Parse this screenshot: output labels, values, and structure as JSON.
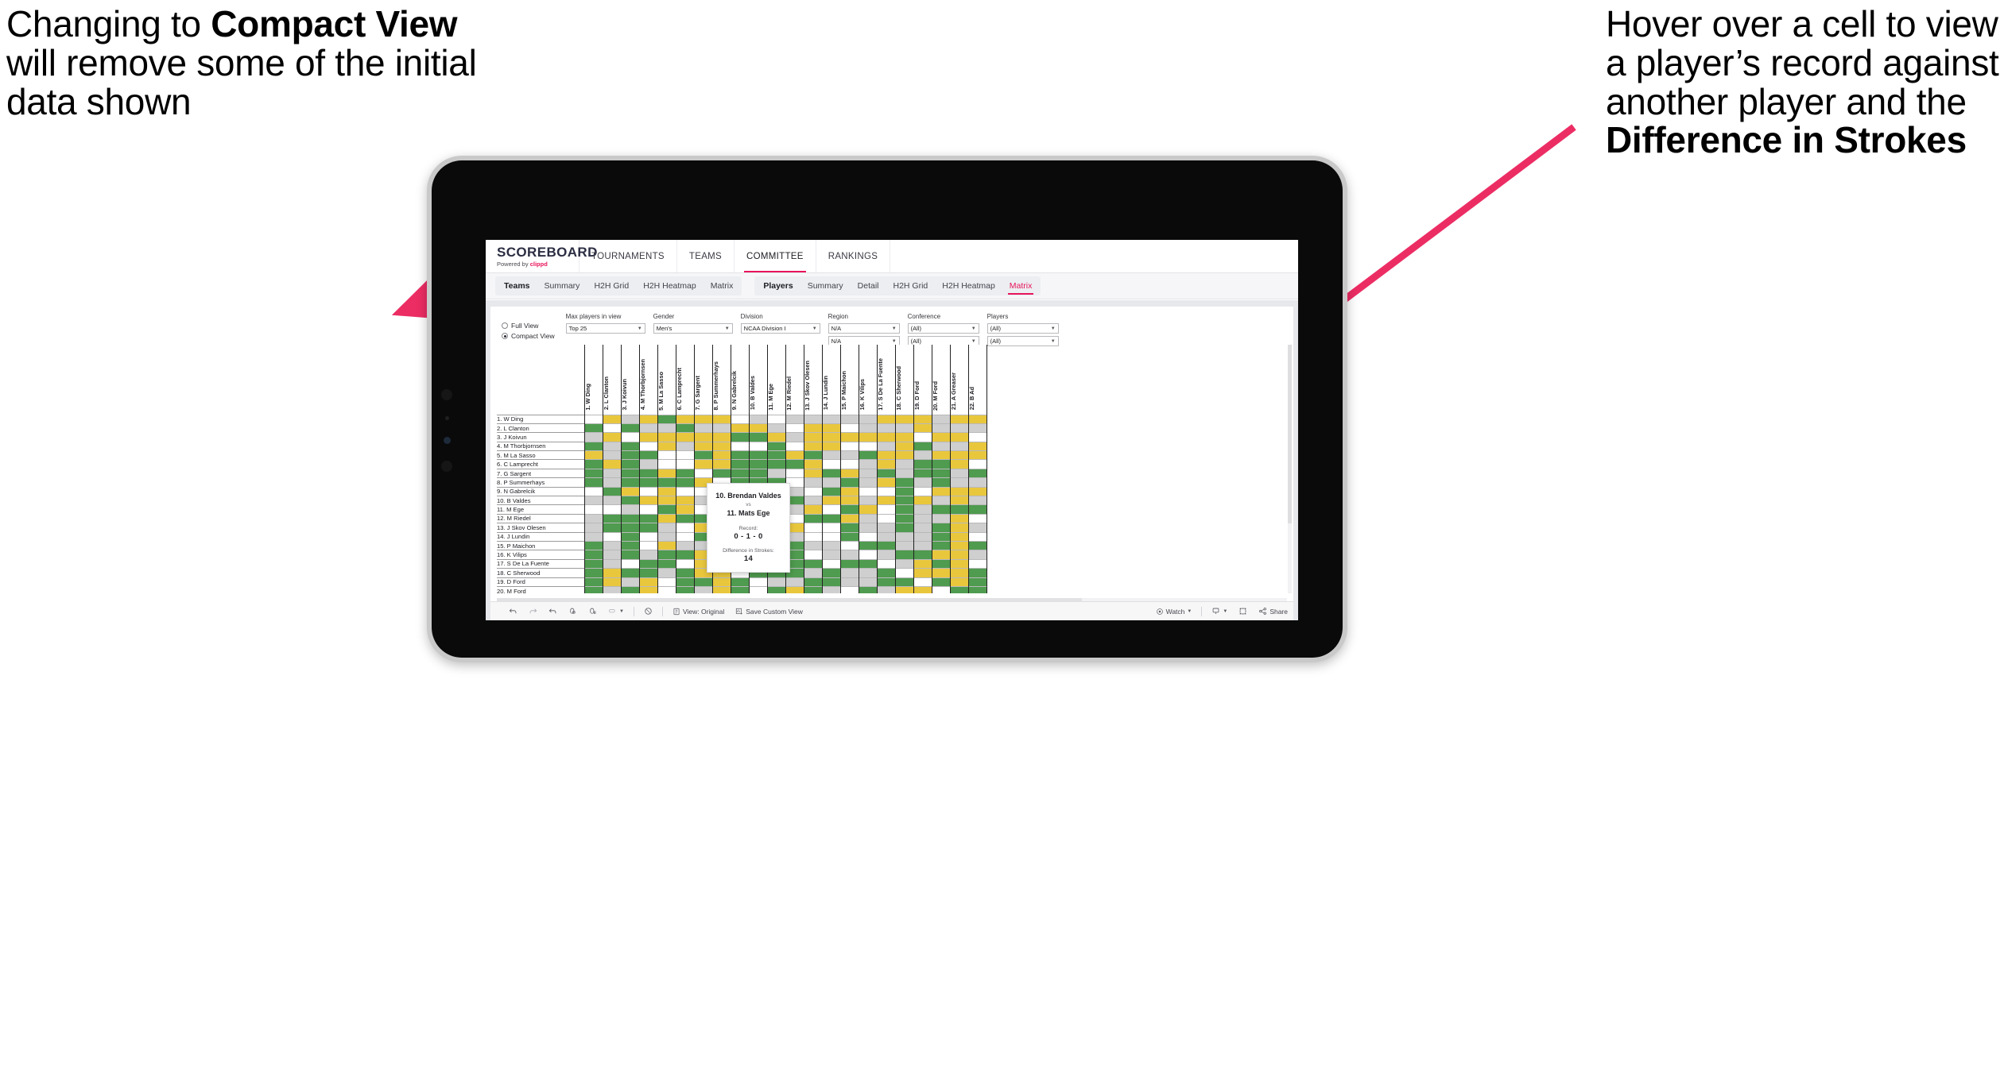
{
  "annotations": {
    "left": {
      "line1": "Changing to ",
      "bold": "Compact View",
      "line2": " will remove some of the initial data shown"
    },
    "right": {
      "line1": "Hover over a cell to view a player’s record against another player and the ",
      "bold": "Difference in Strokes"
    },
    "arrow_color": "#ec2d64"
  },
  "app": {
    "brand": {
      "logo": "SCOREBOARD",
      "powered_prefix": "Powered by ",
      "powered_brand": "clippd"
    },
    "topnav": [
      {
        "label": "TOURNAMENTS",
        "active": false
      },
      {
        "label": "TEAMS",
        "active": false
      },
      {
        "label": "COMMITTEE",
        "active": true
      },
      {
        "label": "RANKINGS",
        "active": false
      }
    ],
    "subnav": {
      "group1": [
        {
          "label": "Teams",
          "lead": true,
          "active": false
        },
        {
          "label": "Summary",
          "active": false
        },
        {
          "label": "H2H Grid",
          "active": false
        },
        {
          "label": "H2H Heatmap",
          "active": false
        },
        {
          "label": "Matrix",
          "active": false
        }
      ],
      "group2": [
        {
          "label": "Players",
          "lead": true,
          "active": false
        },
        {
          "label": "Summary",
          "active": false
        },
        {
          "label": "Detail",
          "active": false
        },
        {
          "label": "H2H Grid",
          "active": false
        },
        {
          "label": "H2H Heatmap",
          "active": false
        },
        {
          "label": "Matrix",
          "active": true
        }
      ]
    },
    "view_toggle": {
      "full": "Full View",
      "compact": "Compact View",
      "selected": "Compact View"
    },
    "filters": [
      {
        "label": "Max players in view",
        "value": "Top 25",
        "value2": null
      },
      {
        "label": "Gender",
        "value": "Men's",
        "value2": null
      },
      {
        "label": "Division",
        "value": "NCAA Division I",
        "value2": null
      },
      {
        "label": "Region",
        "value": "N/A",
        "value2": "N/A"
      },
      {
        "label": "Conference",
        "value": "(All)",
        "value2": "(All)"
      },
      {
        "label": "Players",
        "value": "(All)",
        "value2": "(All)"
      }
    ],
    "tooltip": {
      "player_a": "10. Brendan Valdes",
      "vs": "vs",
      "player_b": "11. Mats Ege",
      "record_label": "Record:",
      "record_value": "0 - 1 - 0",
      "strokes_label": "Difference in Strokes:",
      "strokes_value": "14"
    },
    "toolbar": {
      "view_label": "View: Original",
      "save_label": "Save Custom View",
      "watch_label": "Watch",
      "share_label": "Share"
    }
  },
  "chart_data": {
    "type": "heatmap",
    "title": "Player Head-to-Head Matrix",
    "xlabel": "",
    "ylabel": "",
    "grid": true,
    "legend": "none",
    "color_map": {
      "g": "#4f9b4f",
      "y": "#e9c73d",
      "a": "#cfcfcf",
      "w": "#ffffff"
    },
    "color_meaning": {
      "g": "win",
      "y": "loss",
      "a": "tie-or-no-data",
      "w": "self-or-blank"
    },
    "rows": [
      "1. W Ding",
      "2. L Clanton",
      "3. J Koivun",
      "4. M Thorbjornsen",
      "5. M La Sasso",
      "6. C Lamprecht",
      "7. G Sargent",
      "8. P Summerhays",
      "9. N Gabrelcik",
      "10. B Valdes",
      "11. M Ege",
      "12. M Riedel",
      "13. J Skov Olesen",
      "14. J Lundin",
      "15. P Maichon",
      "16. K Vilips",
      "17. S De La Fuente",
      "18. C Sherwood",
      "19. D Ford",
      "20. M Ford"
    ],
    "columns": [
      "1. W Ding",
      "2. L Clanton",
      "3. J Koivun",
      "4. M Thorbjornsen",
      "5. M La Sasso",
      "6. C Lamprecht",
      "7. G Sargent",
      "8. P Summerhays",
      "9. N Gabrelcik",
      "10. B Valdes",
      "11. M Ege",
      "12. M Riedel",
      "13. J Skov Olesen",
      "14. J Lundin",
      "15. P Maichon",
      "16. K Vilips",
      "17. S De La Fuente",
      "18. C Sherwood",
      "19. D Ford",
      "20. M Ford",
      "21. A Greaser",
      "22. B Ad"
    ],
    "cells": [
      [
        "w",
        "y",
        "a",
        "y",
        "g",
        "y",
        "y",
        "y",
        "w",
        "a",
        "w",
        "a",
        "a",
        "a",
        "a",
        "a",
        "y",
        "y",
        "y",
        "a",
        "y",
        "y"
      ],
      [
        "g",
        "w",
        "g",
        "a",
        "a",
        "g",
        "a",
        "a",
        "y",
        "y",
        "a",
        "w",
        "y",
        "y",
        "w",
        "a",
        "a",
        "a",
        "y",
        "a",
        "a",
        "a"
      ],
      [
        "a",
        "y",
        "w",
        "y",
        "y",
        "y",
        "y",
        "y",
        "g",
        "g",
        "y",
        "a",
        "y",
        "y",
        "y",
        "y",
        "y",
        "y",
        "w",
        "y",
        "y",
        "w"
      ],
      [
        "g",
        "a",
        "g",
        "w",
        "y",
        "a",
        "y",
        "y",
        "w",
        "w",
        "g",
        "w",
        "y",
        "y",
        "w",
        "w",
        "a",
        "y",
        "g",
        "a",
        "a",
        "y"
      ],
      [
        "y",
        "a",
        "g",
        "g",
        "w",
        "w",
        "g",
        "y",
        "g",
        "g",
        "g",
        "y",
        "g",
        "a",
        "a",
        "g",
        "y",
        "y",
        "a",
        "y",
        "y",
        "y"
      ],
      [
        "g",
        "y",
        "g",
        "a",
        "w",
        "w",
        "y",
        "y",
        "g",
        "g",
        "g",
        "g",
        "y",
        "w",
        "w",
        "a",
        "y",
        "a",
        "g",
        "g",
        "y",
        "w"
      ],
      [
        "g",
        "a",
        "g",
        "g",
        "y",
        "g",
        "w",
        "g",
        "g",
        "g",
        "a",
        "w",
        "y",
        "g",
        "y",
        "a",
        "g",
        "a",
        "g",
        "g",
        "a",
        "g"
      ],
      [
        "g",
        "a",
        "g",
        "g",
        "g",
        "g",
        "y",
        "w",
        "g",
        "g",
        "g",
        "w",
        "a",
        "a",
        "g",
        "a",
        "y",
        "g",
        "a",
        "g",
        "a",
        "a"
      ],
      [
        "w",
        "g",
        "y",
        "w",
        "y",
        "w",
        "w",
        "y",
        "w",
        "w",
        "y",
        "a",
        "w",
        "g",
        "y",
        "w",
        "w",
        "g",
        "w",
        "y",
        "y",
        "y"
      ],
      [
        "a",
        "a",
        "g",
        "y",
        "y",
        "y",
        "a",
        "y",
        "g",
        "w",
        "w",
        "g",
        "a",
        "y",
        "y",
        "a",
        "y",
        "g",
        "y",
        "a",
        "y",
        "a"
      ],
      [
        "w",
        "w",
        "a",
        "w",
        "g",
        "y",
        "w",
        "w",
        "a",
        "w",
        "w",
        "a",
        "y",
        "w",
        "g",
        "y",
        "w",
        "g",
        "a",
        "g",
        "g",
        "g"
      ],
      [
        "a",
        "g",
        "g",
        "g",
        "y",
        "g",
        "g",
        "a",
        "w",
        "a",
        "y",
        "w",
        "g",
        "g",
        "y",
        "a",
        "w",
        "g",
        "a",
        "a",
        "y",
        "w"
      ],
      [
        "a",
        "g",
        "g",
        "g",
        "a",
        "w",
        "y",
        "a",
        "y",
        "a",
        "g",
        "y",
        "w",
        "w",
        "g",
        "a",
        "a",
        "g",
        "a",
        "g",
        "y",
        "a"
      ],
      [
        "a",
        "w",
        "g",
        "w",
        "a",
        "w",
        "g",
        "y",
        "g",
        "a",
        "g",
        "a",
        "w",
        "w",
        "g",
        "w",
        "a",
        "a",
        "a",
        "g",
        "y",
        "w"
      ],
      [
        "g",
        "a",
        "g",
        "w",
        "y",
        "a",
        "a",
        "a",
        "w",
        "g",
        "g",
        "g",
        "a",
        "a",
        "w",
        "g",
        "g",
        "a",
        "a",
        "g",
        "y",
        "g"
      ],
      [
        "g",
        "a",
        "g",
        "a",
        "g",
        "g",
        "y",
        "g",
        "w",
        "g",
        "g",
        "g",
        "w",
        "a",
        "a",
        "w",
        "a",
        "g",
        "g",
        "y",
        "y",
        "a"
      ],
      [
        "g",
        "a",
        "w",
        "g",
        "g",
        "w",
        "y",
        "a",
        "w",
        "g",
        "y",
        "g",
        "g",
        "w",
        "g",
        "g",
        "w",
        "a",
        "y",
        "g",
        "y",
        "w"
      ],
      [
        "g",
        "y",
        "g",
        "g",
        "a",
        "g",
        "y",
        "y",
        "w",
        "g",
        "g",
        "g",
        "a",
        "g",
        "a",
        "a",
        "g",
        "w",
        "y",
        "y",
        "y",
        "g"
      ],
      [
        "g",
        "y",
        "a",
        "y",
        "w",
        "g",
        "g",
        "y",
        "g",
        "w",
        "a",
        "a",
        "g",
        "g",
        "a",
        "a",
        "g",
        "g",
        "w",
        "g",
        "y",
        "g"
      ],
      [
        "g",
        "a",
        "g",
        "y",
        "w",
        "g",
        "a",
        "y",
        "g",
        "w",
        "g",
        "y",
        "g",
        "a",
        "w",
        "g",
        "a",
        "y",
        "y",
        "w",
        "g",
        "g"
      ]
    ]
  }
}
